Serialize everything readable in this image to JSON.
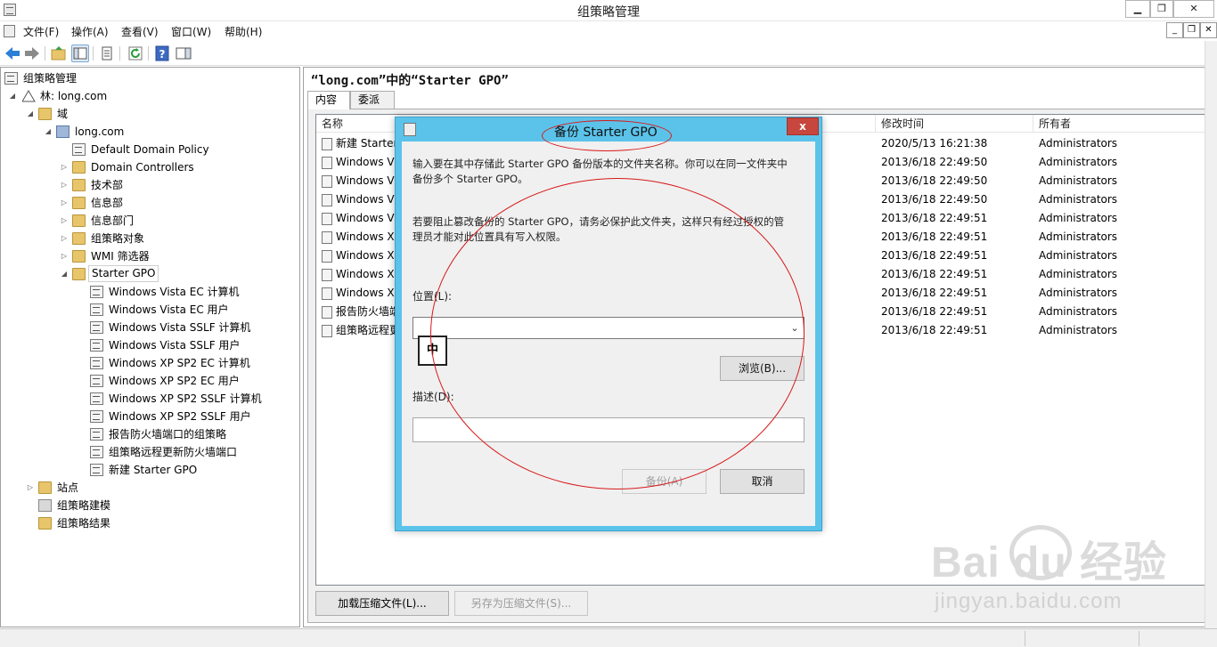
{
  "window": {
    "title": "组策略管理",
    "buttons": {
      "minimize": "▁",
      "maximize": "❐",
      "close": "✕"
    }
  },
  "menu": {
    "items": [
      "文件(F)",
      "操作(A)",
      "查看(V)",
      "窗口(W)",
      "帮助(H)"
    ]
  },
  "toolbar": {
    "icons": [
      "back-icon",
      "forward-icon",
      "folder-up-icon",
      "show-hide-tree-icon",
      "properties-icon",
      "refresh-icon",
      "help-icon",
      "action-pane-icon"
    ]
  },
  "tree": {
    "root": "组策略管理",
    "forest": "林: long.com",
    "domains": "域",
    "domain": "long.com",
    "items": [
      "Default Domain Policy",
      "Domain Controllers",
      "技术部",
      "信息部",
      "信息部门",
      "组策略对象",
      "WMI 筛选器",
      "Starter GPO"
    ],
    "starter_gpos": [
      "Windows Vista EC 计算机",
      "Windows Vista EC 用户",
      "Windows Vista SSLF 计算机",
      "Windows Vista SSLF 用户",
      "Windows XP SP2 EC 计算机",
      "Windows XP SP2 EC 用户",
      "Windows XP SP2 SSLF 计算机",
      "Windows XP SP2 SSLF 用户",
      "报告防火墙端口的组策略",
      "组策略远程更新防火墙端口",
      "新建 Starter GPO"
    ],
    "sites": "站点",
    "modeling": "组策略建模",
    "results": "组策略结果"
  },
  "main": {
    "title": "“long.com”中的“Starter GPO”",
    "tabs": [
      "内容",
      "委派"
    ],
    "columns": {
      "name": "名称",
      "modified": "修改时间",
      "owner": "所有者"
    },
    "rows": [
      {
        "name": "新建 Starter",
        "modified": "2020/5/13 16:21:38",
        "owner": "Administrators"
      },
      {
        "name": "Windows Vi",
        "modified": "2013/6/18 22:49:50",
        "owner": "Administrators"
      },
      {
        "name": "Windows Vi",
        "modified": "2013/6/18 22:49:50",
        "owner": "Administrators"
      },
      {
        "name": "Windows Vi",
        "modified": "2013/6/18 22:49:50",
        "owner": "Administrators"
      },
      {
        "name": "Windows Vi",
        "modified": "2013/6/18 22:49:51",
        "owner": "Administrators"
      },
      {
        "name": "Windows XI",
        "modified": "2013/6/18 22:49:51",
        "owner": "Administrators"
      },
      {
        "name": "Windows XI",
        "modified": "2013/6/18 22:49:51",
        "owner": "Administrators"
      },
      {
        "name": "Windows XI",
        "modified": "2013/6/18 22:49:51",
        "owner": "Administrators"
      },
      {
        "name": "Windows XI",
        "modified": "2013/6/18 22:49:51",
        "owner": "Administrators"
      },
      {
        "name": "报告防火墙端",
        "modified": "2013/6/18 22:49:51",
        "owner": "Administrators"
      },
      {
        "name": "组策略远程更",
        "modified": "2013/6/18 22:49:51",
        "owner": "Administrators"
      }
    ],
    "load_cab_button": "加载压缩文件(L)...",
    "save_cab_button": "另存为压缩文件(S)..."
  },
  "dialog": {
    "title": "备份 Starter GPO",
    "close": "x",
    "description": "输入要在其中存储此 Starter GPO 备份版本的文件夹名称。你可以在同一文件夹中储多个 Starter GPO。",
    "desc_line1": "输入要在其中存储此 Starter GPO 备份版本的文件夹名称。你可以在同一文件夹中",
    "desc_line2": "备份多个 Starter GPO。",
    "warn_line1": "若要阻止篡改备份的 Starter GPO，请务必保护此文件夹，这样只有经过授权的管",
    "warn_line2": "理员才能对此位置具有写入权限。",
    "location_label": "位置(L):",
    "location_value": "",
    "ime_indicator": "中",
    "browse_button": "浏览(B)...",
    "description_label": "描述(D):",
    "description_value": "",
    "backup_button": "备份(A)",
    "cancel_button": "取消"
  },
  "watermark": {
    "main": "Bai du 经验",
    "sub": "jingyan.baidu.com"
  },
  "colors": {
    "dialog_frame": "#5bc3ea",
    "close_red": "#c7463d",
    "annotation_red": "#d81818"
  }
}
